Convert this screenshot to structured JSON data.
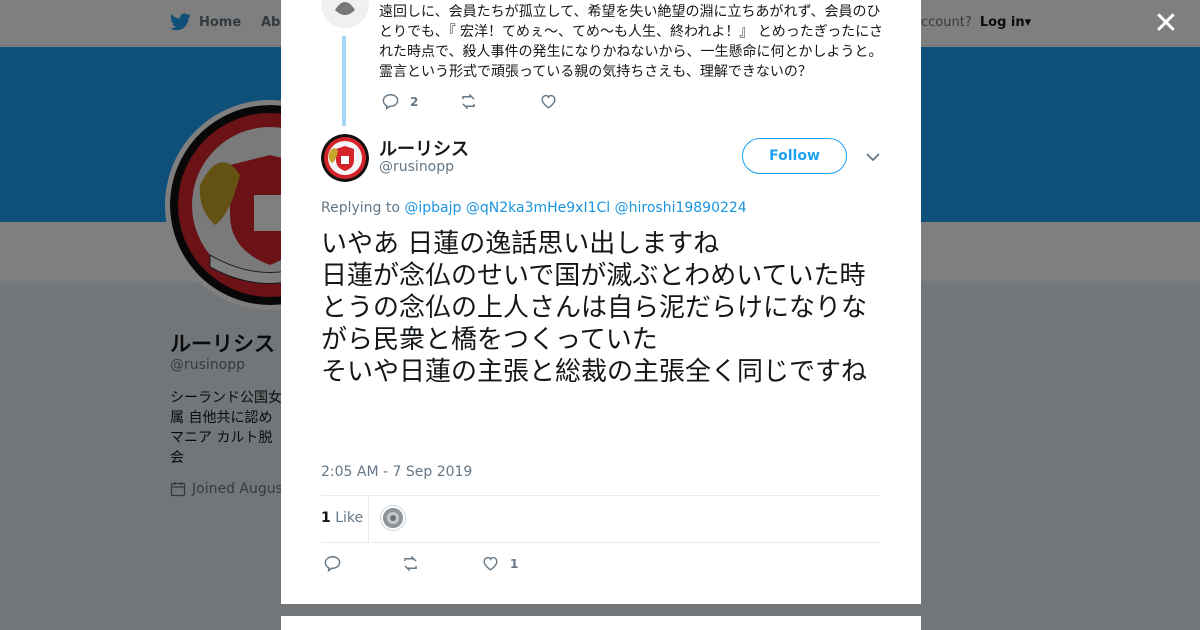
{
  "nav": {
    "home_label": "Home",
    "about_label": "Abo",
    "account_prompt": "ccount?",
    "login_label": "Log in"
  },
  "profile": {
    "name": "ルーリシス",
    "handle": "@rusinopp",
    "bio": "シーランド公国女\n属 自他共に認め\nマニア カルト脱会\nす",
    "joined": "Joined August"
  },
  "previous_tweet": {
    "text": "遠回しに、会員たちが孤立して、希望を失い絶望の淵に立ちあがれず、会員のひとりでも、『 宏洋！てめぇ～、てめ～も人生、終われよ！』 とめったぎったにされた時点で、殺人事件の発生になりかねないから、一生懸命に何とかしようと。霊言という形式で頑張っている親の気持ちさえも、理解できないの？",
    "reply_count": "2"
  },
  "tweet": {
    "author_name": "ルーリシス",
    "author_handle": "@rusinopp",
    "follow_label": "Follow",
    "replying_prefix": "Replying to",
    "mentions": [
      "@ipbajp",
      "@qN2ka3mHe9xI1Cl",
      "@hiroshi19890224"
    ],
    "text_lines": [
      "いやあ 日蓮の逸話思い出しますね",
      "日蓮が念仏のせいで国が滅ぶとわめいていた時",
      "とうの念仏の上人さんは自ら泥だらけになりながら民衆と橋をつくっていた",
      "そいや日蓮の主張と総裁の主張全く同じですね"
    ],
    "timestamp": "2:05 AM - 7 Sep 2019",
    "like_count": "1",
    "like_label": "Like",
    "action_like_count": "1"
  },
  "colors": {
    "brand_blue": "#1da1f2",
    "link_blue": "#1b95e0",
    "thread_line": "#a3d7f7",
    "muted_text": "#657786"
  },
  "icons": [
    "twitter-bird-icon",
    "calendar-icon",
    "close-icon",
    "reply-icon",
    "retweet-icon",
    "heart-icon",
    "chevron-down-icon"
  ]
}
